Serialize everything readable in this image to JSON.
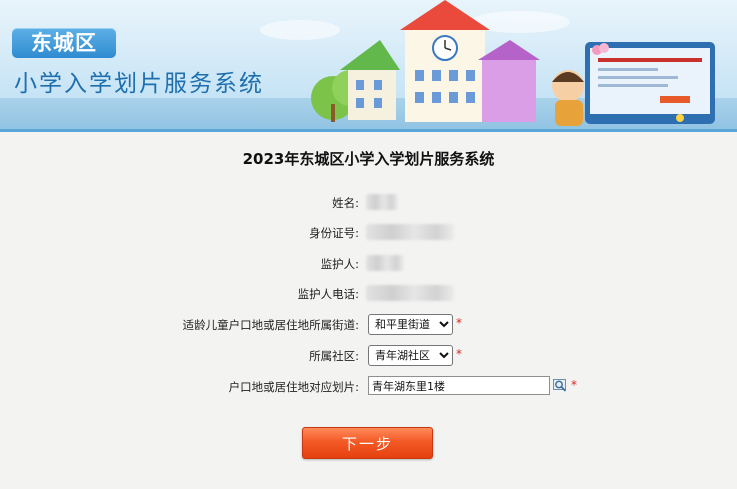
{
  "banner": {
    "district": "东城区",
    "system_name": "小学入学划片服务系统"
  },
  "page_title": "2023年东城区小学入学划片服务系统",
  "fields": {
    "name_label": "姓名:",
    "id_label": "身份证号:",
    "guardian_label": "监护人:",
    "guardian_phone_label": "监护人电话:",
    "street_label": "适龄儿童户口地或居住地所属街道:",
    "street_value": "和平里街道",
    "community_label": "所属社区:",
    "community_value": "青年湖社区",
    "zone_label": "户口地或居住地对应划片:",
    "zone_value": "青年湖东里1楼"
  },
  "required_mark": "*",
  "next_button": "下一步",
  "colors": {
    "accent": "#2f8bd0",
    "required": "#d8271c",
    "button": "#f35a26"
  }
}
